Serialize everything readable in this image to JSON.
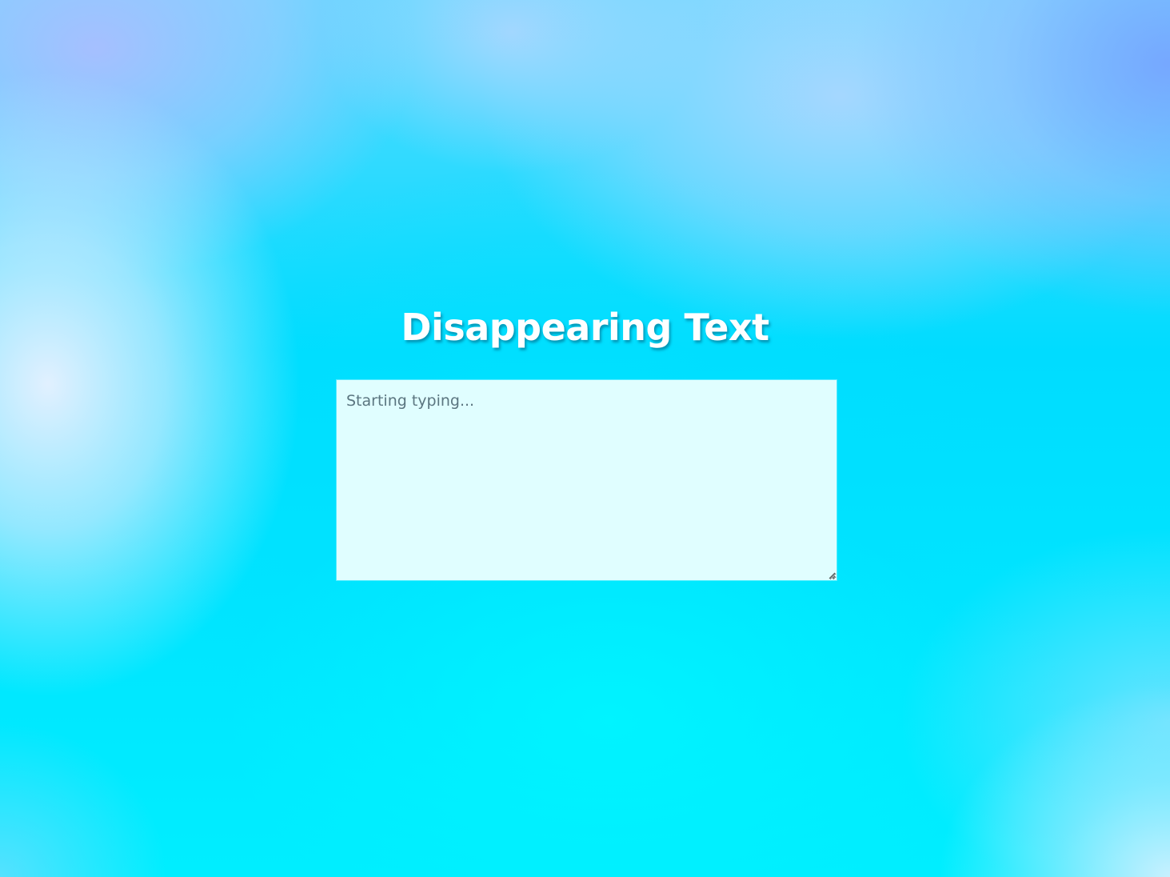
{
  "page": {
    "title": "Disappearing Text"
  },
  "editor": {
    "placeholder": "Starting typing...",
    "value": ""
  },
  "colors": {
    "title_text": "#ffffff",
    "editor_background": "#e0feff",
    "background_primary": "#00e4ff",
    "background_accent": "#8fb4ff"
  }
}
